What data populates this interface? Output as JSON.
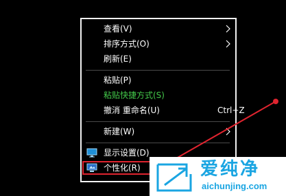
{
  "context_menu": {
    "items": [
      {
        "label": "查看(V)",
        "has_submenu": true
      },
      {
        "label": "排序方式(O)",
        "has_submenu": true
      },
      {
        "label": "刷新(E)"
      },
      {
        "label": "粘贴(P)"
      },
      {
        "label": "粘贴快捷方式(S)",
        "color": "#43c94a"
      },
      {
        "label": "撤消 重命名(U)",
        "shortcut": "Ctrl+Z"
      },
      {
        "label": "新建(W)",
        "has_submenu": true
      },
      {
        "label": "显示设置(D)",
        "icon": "display-settings-icon"
      },
      {
        "label": "个性化(R)",
        "icon": "personalize-icon",
        "highlighted": true
      }
    ]
  },
  "annotation": {
    "color": "#e0242f"
  },
  "watermark": {
    "title": "爱纯净",
    "url": "aichunjing.com",
    "color": "#1aa5e2"
  }
}
